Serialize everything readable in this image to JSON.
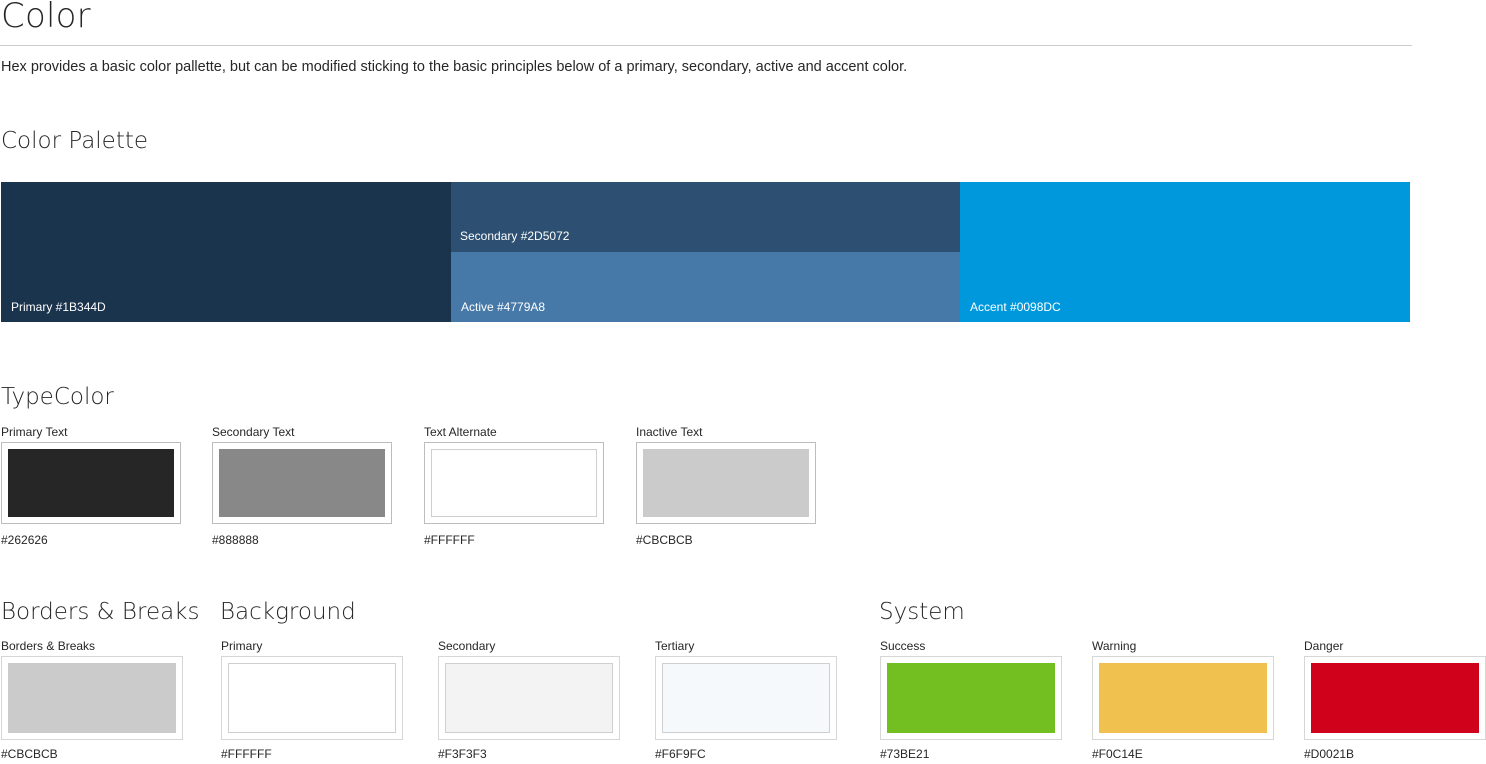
{
  "page": {
    "title": "Color",
    "intro": "Hex provides a basic color pallette, but can be modified sticking to the basic principles below of a primary, secondary, active and accent color."
  },
  "palette": {
    "heading": "Color Palette",
    "primary": {
      "label": "Primary #1B344D",
      "color": "#1B344D"
    },
    "secondary": {
      "label": "Secondary #2D5072",
      "color": "#2D5072"
    },
    "active": {
      "label": "Active #4779A8",
      "color": "#4779A8"
    },
    "accent": {
      "label": "Accent #0098DC",
      "color": "#0098DC"
    }
  },
  "type_color": {
    "heading": "TypeColor",
    "swatches": [
      {
        "label": "Primary Text",
        "hex": "#262626",
        "color": "#262626"
      },
      {
        "label": "Secondary Text",
        "hex": "#888888",
        "color": "#888888"
      },
      {
        "label": "Text Alternate",
        "hex": "#FFFFFF",
        "color": "#FFFFFF"
      },
      {
        "label": "Inactive Text",
        "hex": "#CBCBCB",
        "color": "#CBCBCB"
      }
    ]
  },
  "borders": {
    "heading": "Borders & Breaks",
    "swatches": [
      {
        "label": "Borders & Breaks",
        "hex": "#CBCBCB",
        "color": "#CBCBCB"
      }
    ]
  },
  "background": {
    "heading": "Background",
    "swatches": [
      {
        "label": "Primary",
        "hex": "#FFFFFF",
        "color": "#FFFFFF"
      },
      {
        "label": "Secondary",
        "hex": "#F3F3F3",
        "color": "#F3F3F3"
      },
      {
        "label": "Tertiary",
        "hex": "#F6F9FC",
        "color": "#F6F9FC"
      }
    ]
  },
  "system": {
    "heading": "System",
    "swatches": [
      {
        "label": "Success",
        "hex": "#73BE21",
        "color": "#73BE21"
      },
      {
        "label": "Warning",
        "hex": "#F0C14E",
        "color": "#F0C14E"
      },
      {
        "label": "Danger",
        "hex": "#D0021B",
        "color": "#D0021B"
      }
    ]
  }
}
